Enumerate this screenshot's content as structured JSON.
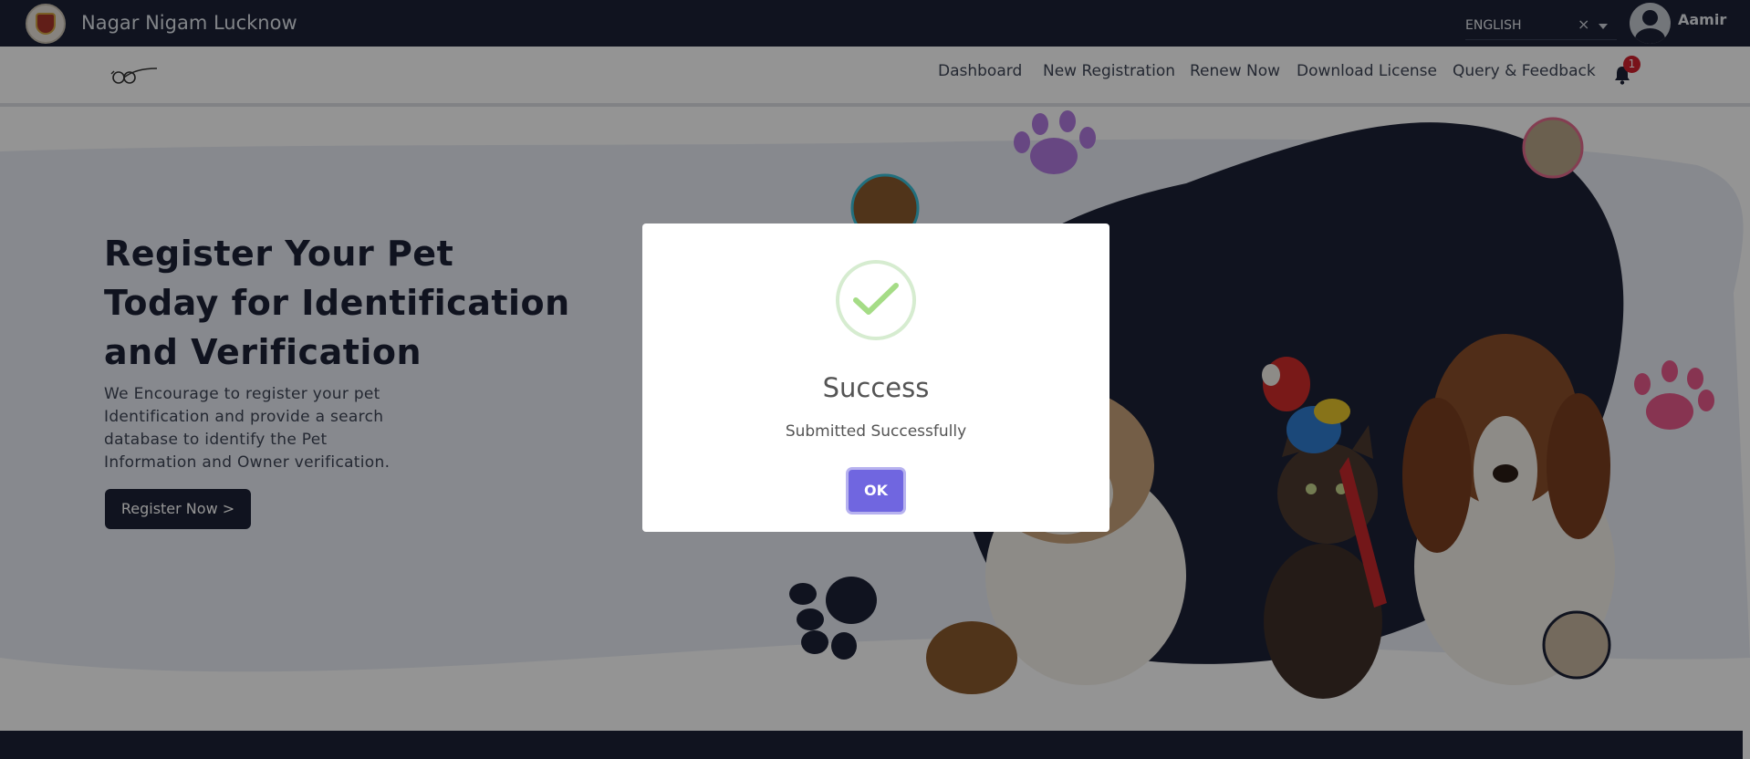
{
  "app": {
    "title": "Nagar Nigam Lucknow",
    "language": "ENGLISH",
    "language_clear": "×",
    "user_name": "Aamir"
  },
  "nav": {
    "items": [
      "Dashboard",
      "New Registration",
      "Renew Now",
      "Download License",
      "Query & Feedback"
    ],
    "notification_count": "1"
  },
  "hero": {
    "heading": "Register Your Pet Today for Identification and Verification",
    "lead": "We Encourage to register your pet Identification and provide a search database to identify the Pet Information and Owner verification.",
    "cta_label": "Register Now >"
  },
  "modal": {
    "title": "Success",
    "message": "Submitted Successfully",
    "ok_label": "OK"
  },
  "colors": {
    "navy": "#1d2236",
    "confirm_button": "#7066e0",
    "success_check": "#a5dc86",
    "paw_purple": "#b27be0",
    "paw_pink": "#e85b8c",
    "badge_red": "#d0202d"
  },
  "icons": [
    "government-emblem-icon",
    "user-avatar-icon",
    "dropdown-caret-icon",
    "clear-icon",
    "brand-logo-icon",
    "bell-icon",
    "paw-print-icon",
    "success-check-icon"
  ]
}
